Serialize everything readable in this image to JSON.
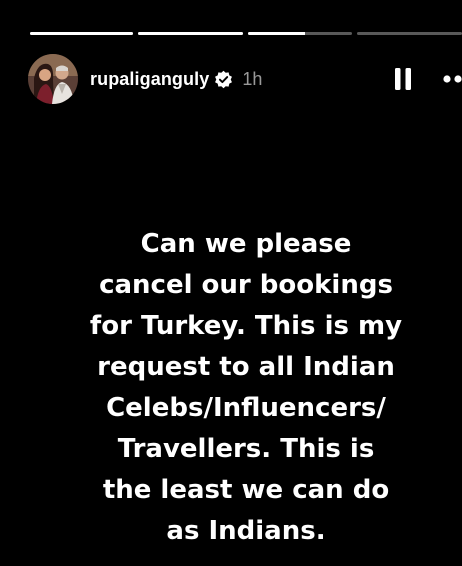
{
  "story": {
    "progress": {
      "segments": [
        1.0,
        1.0,
        0.55,
        0.0
      ]
    },
    "header": {
      "username": "rupaliganguly",
      "verified": true,
      "time": "1h",
      "avatar_icon": "avatar-photo",
      "pause_icon": "pause-icon",
      "more_icon": "more-options-icon"
    },
    "text": {
      "lines": [
        "Can we please",
        "cancel our bookings",
        "for Turkey. This is my",
        "request to all Indian",
        "Celebs/Influencers/",
        "Travellers. This is",
        "the least we can do",
        "as Indians."
      ]
    },
    "colors": {
      "background": "#000000",
      "text": "#ffffff",
      "verified_badge": "#ffffff"
    }
  }
}
